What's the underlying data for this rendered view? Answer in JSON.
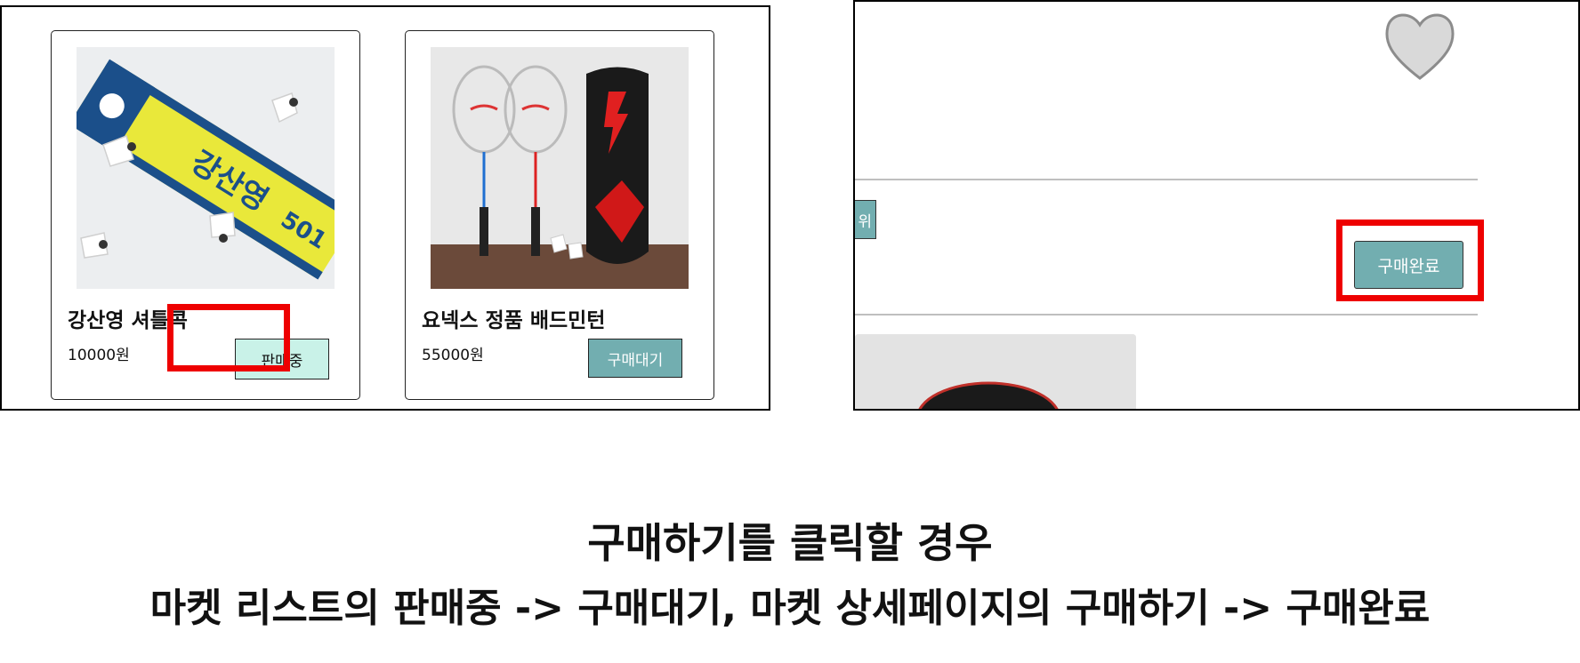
{
  "market_list": {
    "products": [
      {
        "name": "강산영 셔틀콕",
        "price": "10000원",
        "status": "판매중"
      },
      {
        "name": "요넥스 정품 배드민턴",
        "price": "55000원",
        "status": "구매대기"
      }
    ]
  },
  "market_detail": {
    "heart_icon": "heart-outline-icon",
    "edge_button_label": "위",
    "purchase_button": "구매완료"
  },
  "caption": {
    "line1": "구매하기를 클릭할 경우",
    "line2": "마켓 리스트의 판매중 -> 구매대기, 마켓 상세페이지의 구매하기 -> 구매완료"
  },
  "colors": {
    "accent": "#72aeb0",
    "sale_bg": "#c9f2e8",
    "highlight": "#ee0000"
  }
}
